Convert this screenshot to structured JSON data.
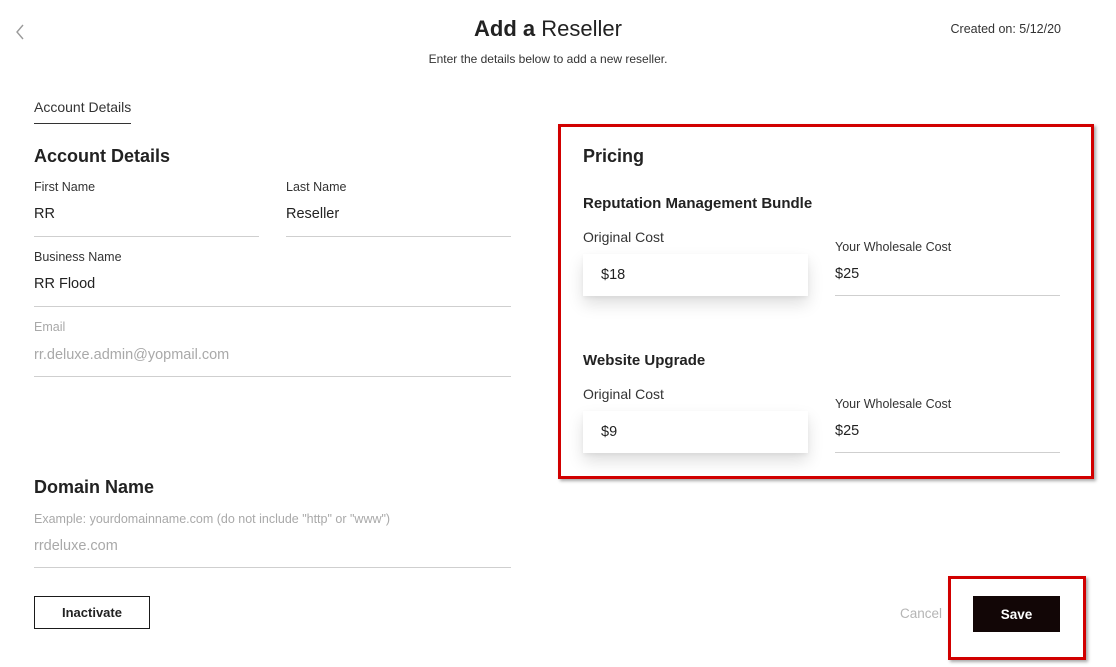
{
  "header": {
    "title_bold": "Add a",
    "title_rest": "Reseller",
    "subtitle": "Enter the details below to add a new reseller.",
    "created_on": "Created on: 5/12/20",
    "back_icon": "chevron-left-icon"
  },
  "tabs": [
    {
      "label": "Account Details",
      "active": true
    }
  ],
  "account": {
    "heading": "Account Details",
    "first_name": {
      "label": "First Name",
      "value": "RR"
    },
    "last_name": {
      "label": "Last Name",
      "value": "Reseller"
    },
    "business_name": {
      "label": "Business Name",
      "value": "RR Flood"
    },
    "email": {
      "label": "Email",
      "value": "rr.deluxe.admin@yopmail.com"
    }
  },
  "domain": {
    "heading": "Domain Name",
    "hint": "Example: yourdomainname.com (do not include \"http\" or \"www\")",
    "value": "rrdeluxe.com"
  },
  "pricing": {
    "heading": "Pricing",
    "items": [
      {
        "name": "Reputation Management Bundle",
        "original_label": "Original Cost",
        "original_value": "$18",
        "wholesale_label": "Your Wholesale Cost",
        "wholesale_value": "$25"
      },
      {
        "name": "Website Upgrade",
        "original_label": "Original Cost",
        "original_value": "$9",
        "wholesale_label": "Your Wholesale Cost",
        "wholesale_value": "$25"
      }
    ]
  },
  "actions": {
    "inactivate": "Inactivate",
    "cancel": "Cancel",
    "save": "Save"
  },
  "colors": {
    "highlight": "#d10000",
    "save_bg": "#120606",
    "muted_text": "#a9a9a9"
  }
}
